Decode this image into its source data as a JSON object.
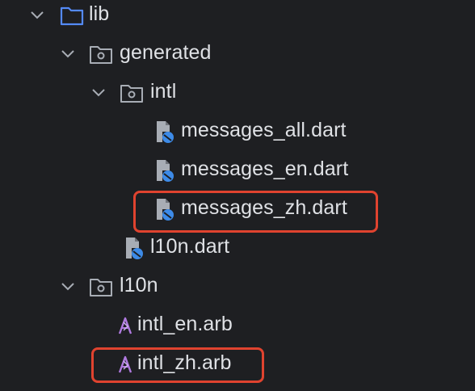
{
  "tree": {
    "items": [
      {
        "label": "lib",
        "icon": "folder-icon",
        "expanded": true
      },
      {
        "label": "generated",
        "icon": "package-folder-icon",
        "expanded": true
      },
      {
        "label": "intl",
        "icon": "package-folder-icon",
        "expanded": true
      },
      {
        "label": "messages_all.dart",
        "icon": "dart-file-icon"
      },
      {
        "label": "messages_en.dart",
        "icon": "dart-file-icon"
      },
      {
        "label": "messages_zh.dart",
        "icon": "dart-file-icon",
        "highlighted": true
      },
      {
        "label": "l10n.dart",
        "icon": "dart-file-icon"
      },
      {
        "label": "l10n",
        "icon": "package-folder-icon",
        "expanded": true
      },
      {
        "label": "intl_en.arb",
        "icon": "arb-file-icon"
      },
      {
        "label": "intl_zh.arb",
        "icon": "arb-file-icon",
        "highlighted": true
      }
    ]
  },
  "colors": {
    "background": "#1e1f22",
    "text": "#dfe1e5",
    "highlight": "#e0432f",
    "folder_blue": "#548af7",
    "dart_blue": "#3d8be8",
    "arb_purple": "#b07ae0",
    "icon_gray": "#a8adb5"
  }
}
